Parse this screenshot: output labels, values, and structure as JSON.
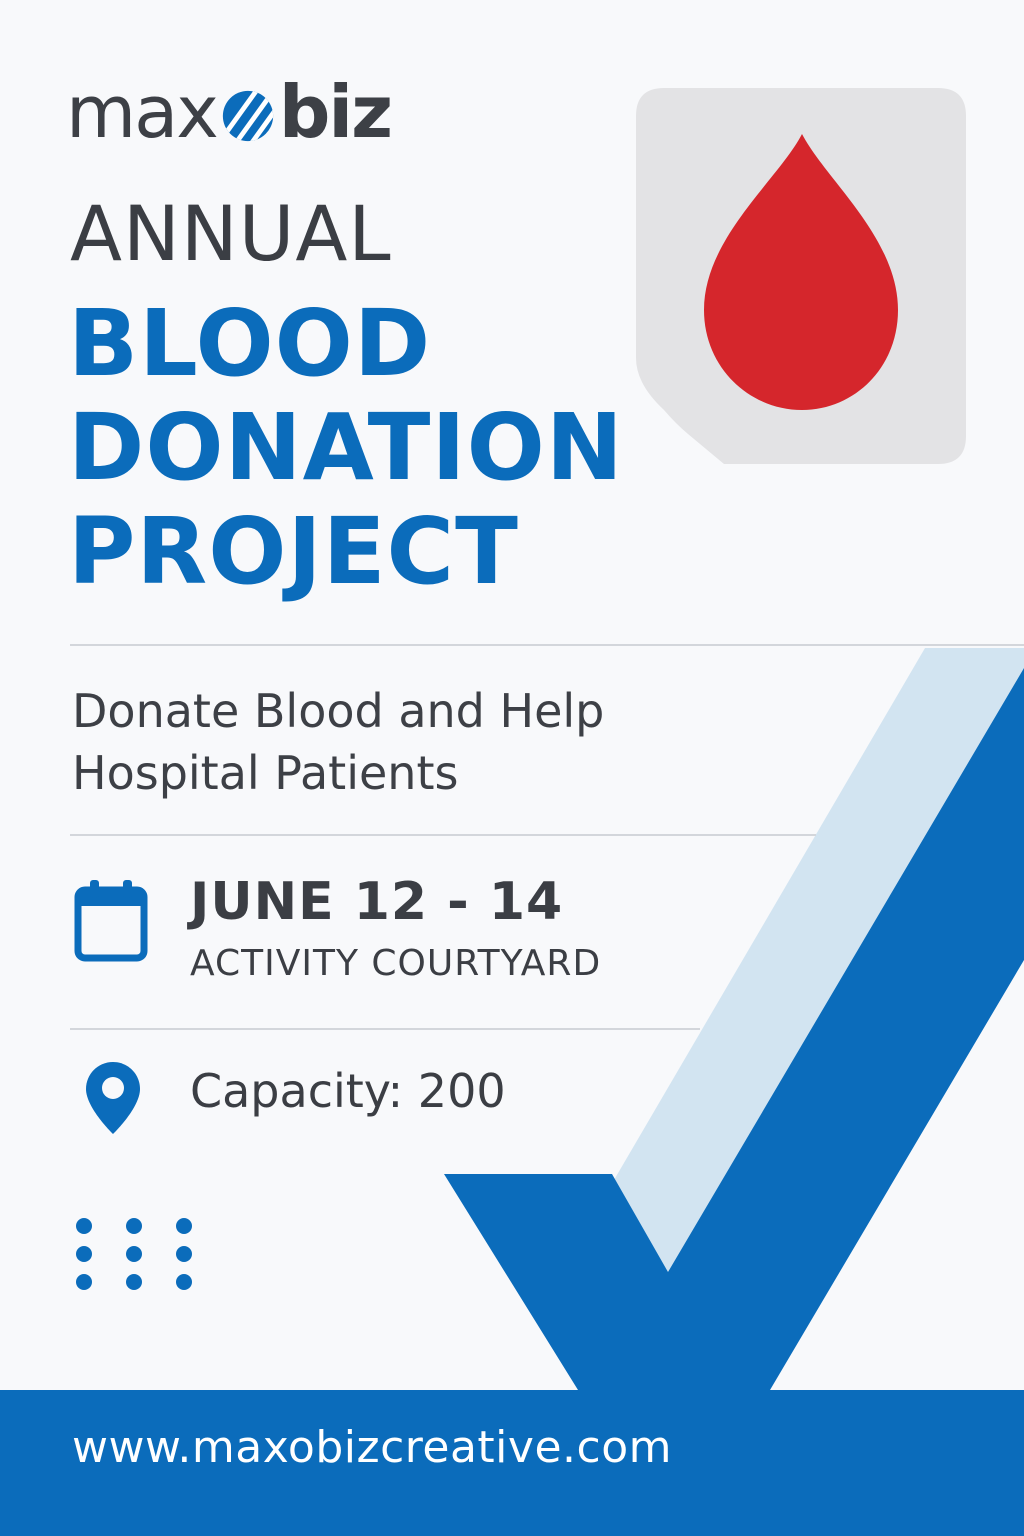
{
  "brand": {
    "logo_part1": "max",
    "logo_part2": "biz",
    "primary_color": "#0b6cbb",
    "light_color": "#d2e4f1",
    "text_color": "#3b3e44",
    "accent_red": "#d5262c"
  },
  "title": {
    "line1": "ANNUAL",
    "line2": "BLOOD",
    "line3": "DONATION",
    "line4": "PROJECT"
  },
  "subtitle": {
    "line1": "Donate Blood and Help",
    "line2": "Hospital Patients"
  },
  "event": {
    "date": "JUNE 12 - 14",
    "venue": "ACTIVITY COURTYARD",
    "capacity": "Capacity: 200",
    "date_icon": "calendar-icon",
    "location_icon": "map-pin-icon"
  },
  "hero_icon": "blood-drop-icon",
  "footer": {
    "url": "www.maxobizcreative.com"
  }
}
